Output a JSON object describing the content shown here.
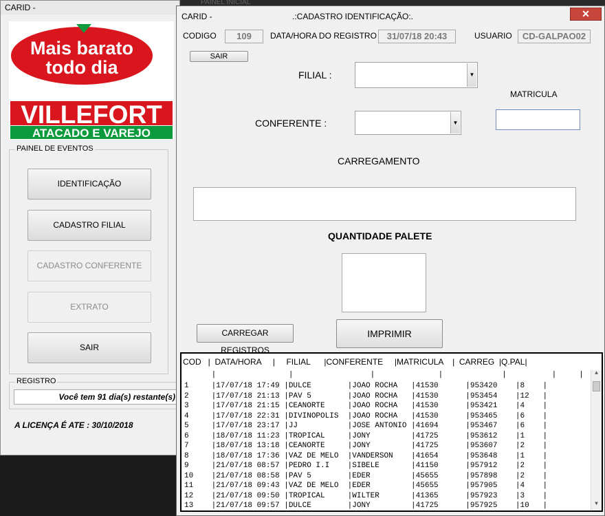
{
  "main_window": {
    "title": "CARID -",
    "logo": {
      "slogan_line1": "Mais barato",
      "slogan_line2": "todo dia",
      "brand": "VILLEFORT",
      "subtitle": "ATACADO E VAREJO",
      "colors": {
        "red": "#d9161d",
        "green": "#0b9a3c"
      }
    },
    "panel_title": "PAINEL DE EVENTOS",
    "buttons": [
      {
        "label": "IDENTIFICAÇÃO",
        "enabled": true
      },
      {
        "label": "CADASTRO FILIAL",
        "enabled": true
      },
      {
        "label": "CADASTRO CONFERENTE",
        "enabled": false
      },
      {
        "label": "EXTRATO",
        "enabled": false
      },
      {
        "label": "SAIR",
        "enabled": true
      }
    ],
    "registro_title": "REGISTRO",
    "registro_text": "Você tem 91 dia(s) restante(s)",
    "license_text": "A LICENÇA É ATE : 30/10/2018"
  },
  "background_title": "PAINEL INICIAL",
  "cad_window": {
    "title_left": "CARID -",
    "title_center": ".:CADASTRO IDENTIFICAÇÃO:.",
    "close_icon": "close-icon",
    "codigo_label": "CODIGO",
    "codigo_value": "109",
    "datahora_label": "DATA/HORA DO REGISTRO",
    "datahora_value": "31/07/18 20:43",
    "usuario_label": "USUARIO",
    "usuario_value": "CD-GALPAO02",
    "sair_label": "SAIR",
    "filial_label": "FILIAL :",
    "matricula_label": "MATRICULA",
    "conferente_label": "CONFERENTE :",
    "carregamento_label": "CARREGAMENTO",
    "quantidade_label": "QUANTIDADE PALETE",
    "carregar_label": "CARREGAR REGISTROS",
    "imprimir_label": "IMPRIMIR"
  },
  "grid": {
    "header": "COD   |  DATA/HORA     |     FILIAL      |CONFERENTE     |MATRICULA    |  CARREG  |Q.PAL|",
    "separator": "      |                |                 |              |             |          |     |",
    "rows": [
      "1     |17/07/18 17:49 |DULCE        |JOAO ROCHA   |41530      |953420    |8    |",
      "2     |17/07/18 21:13 |PAV 5        |JOAO ROCHA   |41530      |953454    |12   |",
      "3     |17/07/18 21:15 |CEANORTE     |JOAO ROCHA   |41530      |953421    |4    |",
      "4     |17/07/18 22:31 |DIVINOPOLIS  |JOAO ROCHA   |41530      |953465    |6    |",
      "5     |17/07/18 23:17 |JJ           |JOSE ANTONIO |41694      |953467    |6    |",
      "6     |18/07/18 11:23 |TROPICAL     |JONY         |41725      |953612    |1    |",
      "7     |18/07/18 13:18 |CEANORTE     |JONY         |41725      |953607    |2    |",
      "8     |18/07/18 17:36 |VAZ DE MELO  |VANDERSON    |41654      |953648    |1    |",
      "9     |21/07/18 08:57 |PEDRO I.I    |SIBELE       |41150      |957912    |2    |",
      "10    |21/07/18 08:58 |PAV 5        |EDER         |45655      |957898    |2    |",
      "11    |21/07/18 09:43 |VAZ DE MELO  |EDER         |45655      |957905    |4    |",
      "12    |21/07/18 09:50 |TROPICAL     |WILTER       |41365      |957923    |3    |",
      "13    |21/07/18 09:57 |DULCE        |JONY         |41725      |957925    |10   |"
    ]
  }
}
